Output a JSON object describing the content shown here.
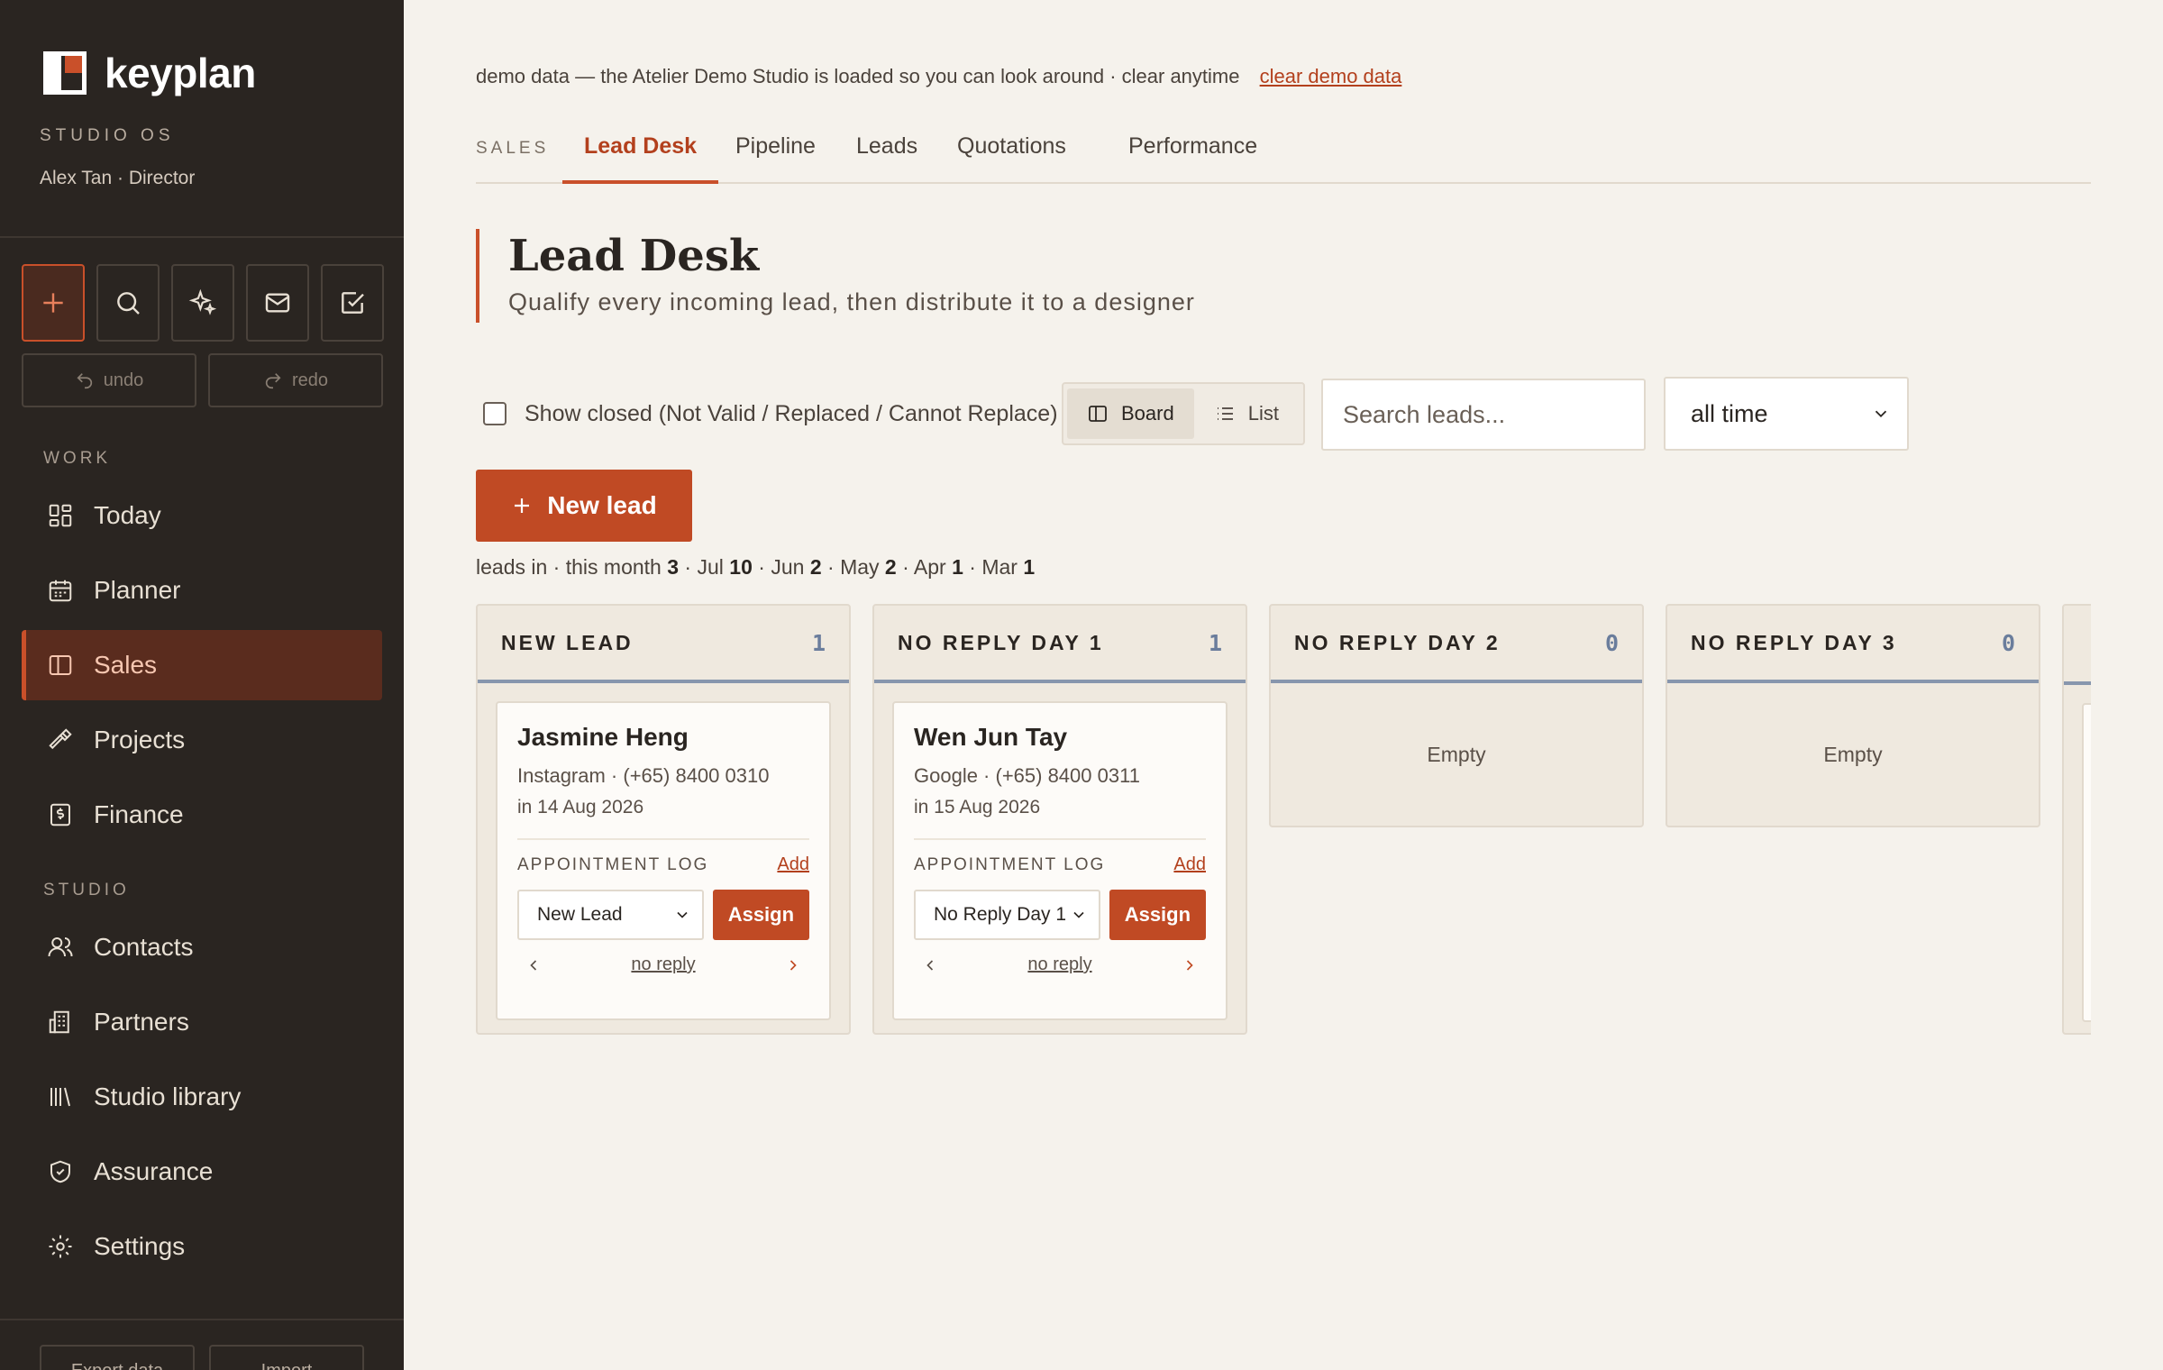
{
  "brand": {
    "name": "keyplan",
    "sub": "STUDIO OS",
    "user": "Alex Tan · Director"
  },
  "quick_actions": [
    {
      "icon": "plus-icon"
    },
    {
      "icon": "search-icon"
    },
    {
      "icon": "sparkle-icon"
    },
    {
      "icon": "mail-icon"
    },
    {
      "icon": "check-square-icon"
    }
  ],
  "history": {
    "undo": "undo",
    "redo": "redo"
  },
  "sidebar": {
    "work_label": "WORK",
    "studio_label": "STUDIO",
    "work_items": [
      {
        "label": "Today",
        "icon": "dashboard-icon"
      },
      {
        "label": "Planner",
        "icon": "calendar-icon"
      },
      {
        "label": "Sales",
        "icon": "columns-icon",
        "active": true
      },
      {
        "label": "Projects",
        "icon": "hammer-icon"
      },
      {
        "label": "Finance",
        "icon": "receipt-icon"
      }
    ],
    "studio_items": [
      {
        "label": "Contacts",
        "icon": "users-icon"
      },
      {
        "label": "Partners",
        "icon": "building-icon"
      },
      {
        "label": "Studio library",
        "icon": "library-icon"
      },
      {
        "label": "Assurance",
        "icon": "shield-icon"
      },
      {
        "label": "Settings",
        "icon": "gear-icon"
      }
    ],
    "footer": {
      "export": "Export data",
      "import": "Import"
    }
  },
  "demo": {
    "text": "demo data — the Atelier Demo Studio is loaded so you can look around · clear anytime",
    "link": "clear demo data"
  },
  "tabs": {
    "section": "SALES",
    "items": [
      "Lead Desk",
      "Pipeline",
      "Leads",
      "Quotations",
      "Performance"
    ],
    "active": "Lead Desk"
  },
  "page": {
    "title": "Lead Desk",
    "subtitle": "Qualify every incoming lead, then distribute it to a designer"
  },
  "toolbar": {
    "show_closed": "Show closed (Not Valid / Replaced / Cannot Replace)",
    "board": "Board",
    "list": "List",
    "search_placeholder": "Search leads...",
    "period": "all time"
  },
  "new_lead": "New lead",
  "counts": {
    "prefix": "leads in",
    "this_month_label": "this month",
    "this_month": "3",
    "jul_label": "Jul",
    "jul": "10",
    "jun_label": "Jun",
    "jun": "2",
    "may_label": "May",
    "may": "2",
    "apr_label": "Apr",
    "apr": "1",
    "mar_label": "Mar",
    "mar": "1"
  },
  "columns": [
    {
      "title": "NEW LEAD",
      "count": "1",
      "card": {
        "name": "Jasmine Heng",
        "meta": "Instagram · (+65) 8400 0310",
        "date": "in 14 Aug 2026",
        "log_label": "APPOINTMENT LOG",
        "add": "Add",
        "stage": "New Lead",
        "assign": "Assign",
        "no_reply": "no reply"
      }
    },
    {
      "title": "NO REPLY DAY 1",
      "count": "1",
      "card": {
        "name": "Wen Jun Tay",
        "meta": "Google · (+65) 8400 0311",
        "date": "in 15 Aug 2026",
        "log_label": "APPOINTMENT LOG",
        "add": "Add",
        "stage": "No Reply Day 1",
        "assign": "Assign",
        "no_reply": "no reply"
      }
    },
    {
      "title": "NO REPLY DAY 2",
      "count": "0",
      "empty": "Empty"
    },
    {
      "title": "NO REPLY DAY 3",
      "count": "0",
      "empty": "Empty"
    }
  ],
  "colors": {
    "accent": "#c04a24",
    "sidebar": "#2a2521",
    "background": "#f5f2ec",
    "column_bar": "#8796ad"
  }
}
